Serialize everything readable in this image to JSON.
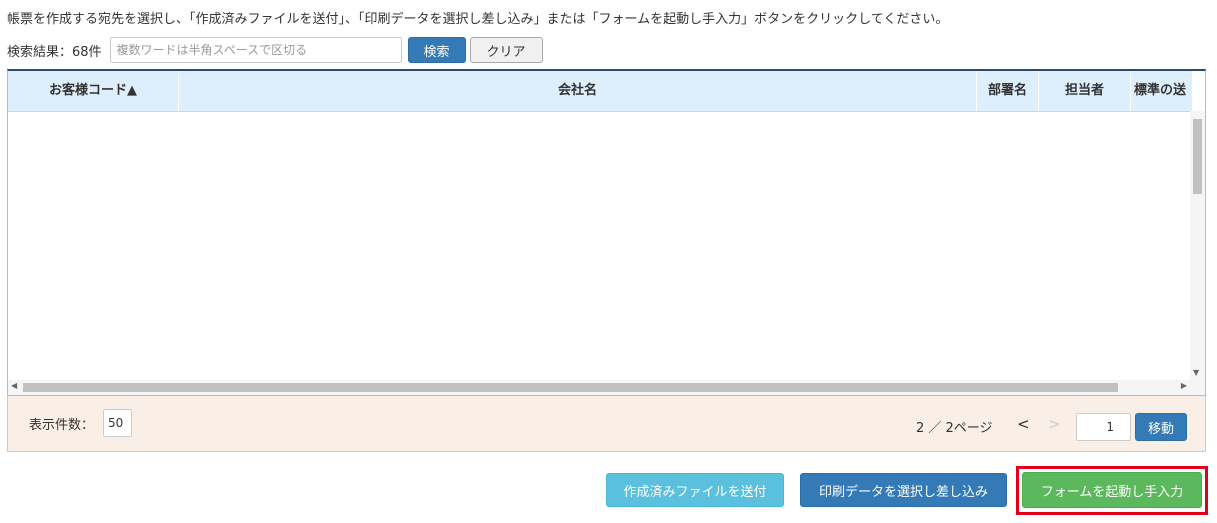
{
  "instruction": "帳票を作成する宛先を選択し、「作成済みファイルを送付」、「印刷データを選択し差し込み」または「フォームを起動し手入力」ボタンをクリックしてください。",
  "search": {
    "result_label": "検索結果：68件",
    "placeholder": "複数ワードは半角スペースで区切る",
    "value": "",
    "search_button": "検索",
    "clear_button": "クリア"
  },
  "table": {
    "columns": [
      "お客様コード▲",
      "会社名",
      "部署名",
      "担当者",
      "標準の送"
    ],
    "rows": []
  },
  "pagination": {
    "per_page_label": "表示件数：",
    "per_page_value": "50",
    "page_info": "2 ／ 2ページ",
    "prev": "<",
    "next": ">",
    "page_input": "1",
    "move_button": "移動"
  },
  "actions": {
    "send_created": "作成済みファイルを送付",
    "merge_print": "印刷データを選択し差し込み",
    "manual_form": "フォームを起動し手入力"
  },
  "colors": {
    "header_bg": "#ddeefc",
    "footer_bg": "#f9efe6",
    "primary": "#337ab7",
    "info": "#5bc0de",
    "success": "#5cb85c",
    "highlight": "#e0001a"
  }
}
